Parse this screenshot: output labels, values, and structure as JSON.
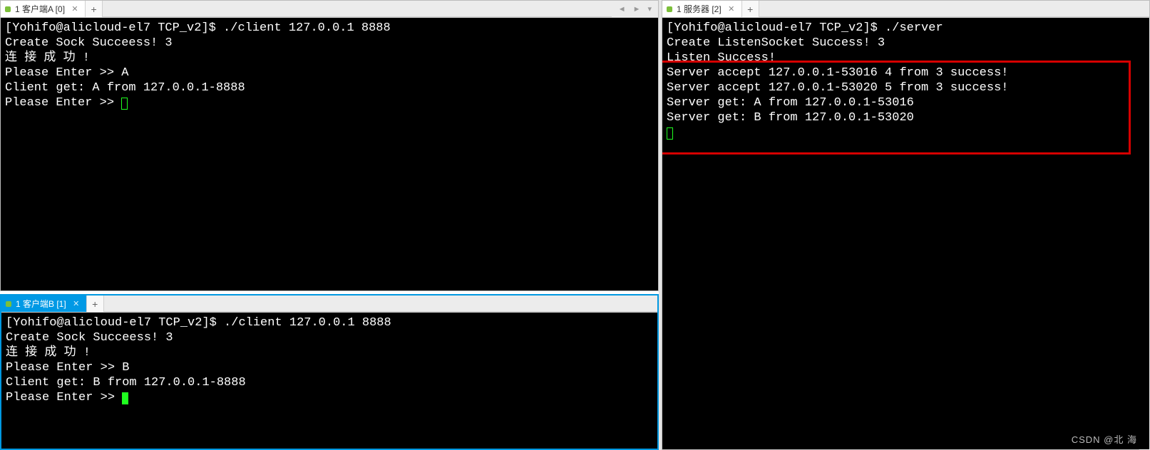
{
  "paneA": {
    "tab_label": "1 客户端A [0]",
    "new_tab": "+",
    "nav": {
      "left": "◄",
      "right": "►",
      "down": "▾"
    },
    "lines": [
      "[Yohifo@alicloud-el7 TCP_v2]$ ./client 127.0.0.1 8888",
      "Create Sock Succeess! 3",
      "连 接 成 功 !",
      "Please Enter >> A",
      "Client get: A from 127.0.0.1-8888",
      "Please Enter >> "
    ]
  },
  "paneB": {
    "tab_label": "1 客户端B [1]",
    "new_tab": "+",
    "lines": [
      "[Yohifo@alicloud-el7 TCP_v2]$ ./client 127.0.0.1 8888",
      "Create Sock Succeess! 3",
      "连 接 成 功 !",
      "Please Enter >> B",
      "Client get: B from 127.0.0.1-8888",
      "Please Enter >> "
    ]
  },
  "paneR": {
    "tab_label": "1 服务器 [2]",
    "new_tab": "+",
    "lines": [
      "[Yohifo@alicloud-el7 TCP_v2]$ ./server",
      "Create ListenSocket Success! 3",
      "Listen Success!",
      "Server accept 127.0.0.1-53016 4 from 3 success!",
      "Server accept 127.0.0.1-53020 5 from 3 success!",
      "Server get: A from 127.0.0.1-53016",
      "Server get: B from 127.0.0.1-53020"
    ]
  },
  "watermark": "CSDN @北  海"
}
